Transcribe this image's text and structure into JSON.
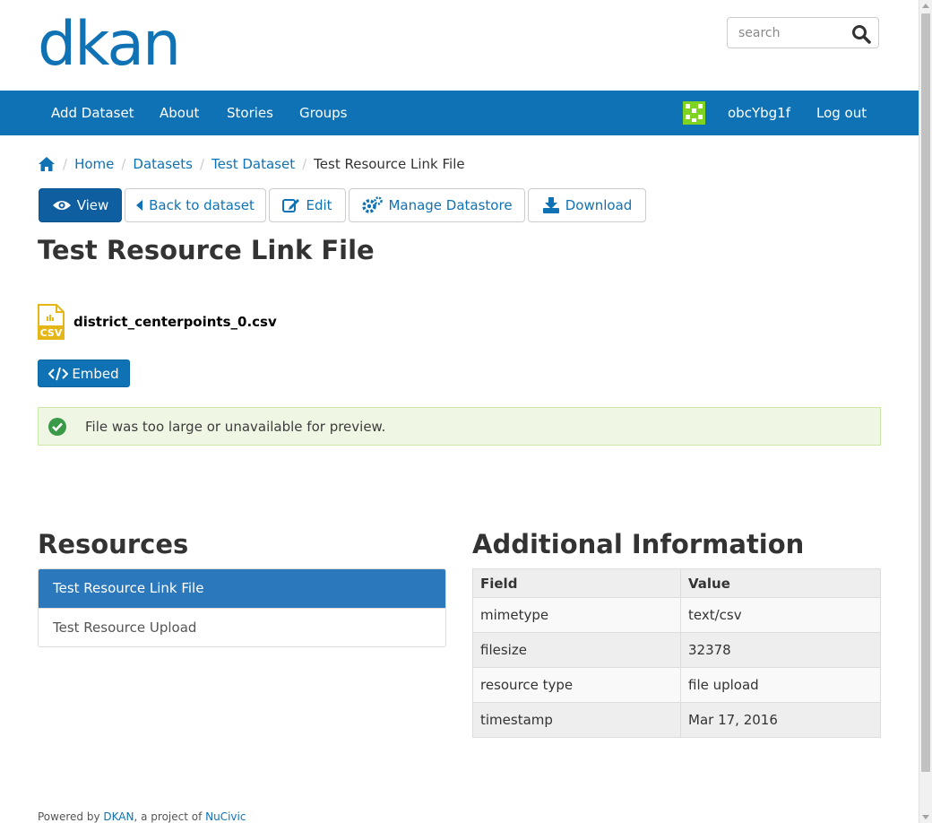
{
  "header": {
    "logo_text": "dkan",
    "search_placeholder": "search"
  },
  "nav": {
    "items": [
      "Add Dataset",
      "About",
      "Stories",
      "Groups"
    ],
    "username": "obcYbg1f",
    "logout": "Log out"
  },
  "breadcrumb": {
    "home": "Home",
    "datasets": "Datasets",
    "dataset": "Test Dataset",
    "current": "Test Resource Link File"
  },
  "actions": {
    "view": "View",
    "back": "Back to dataset",
    "edit": "Edit",
    "manage": "Manage Datastore",
    "download": "Download"
  },
  "resource": {
    "title": "Test Resource Link File",
    "file_name": "district_centerpoints_0.csv",
    "file_type": "CSV",
    "embed_label": "Embed",
    "preview_message": "File was too large or unavailable for preview."
  },
  "resources_section": {
    "heading": "Resources",
    "items": [
      "Test Resource Link File",
      "Test Resource Upload"
    ]
  },
  "additional_info": {
    "heading": "Additional Information",
    "columns": [
      "Field",
      "Value"
    ],
    "rows": [
      [
        "mimetype",
        "text/csv"
      ],
      [
        "filesize",
        "32378"
      ],
      [
        "resource type",
        "file upload"
      ],
      [
        "timestamp",
        "Mar 17, 2016"
      ]
    ]
  },
  "footer": {
    "prefix": "Powered by",
    "dkan_link": "DKAN",
    "middle": ", a project of",
    "nucivic_link": "NuCivic"
  },
  "colors": {
    "brand": "#0f72b5",
    "alert_bg": "#eff7e4",
    "alert_icon": "#3a9a48",
    "csv_icon": "#e4b618"
  }
}
